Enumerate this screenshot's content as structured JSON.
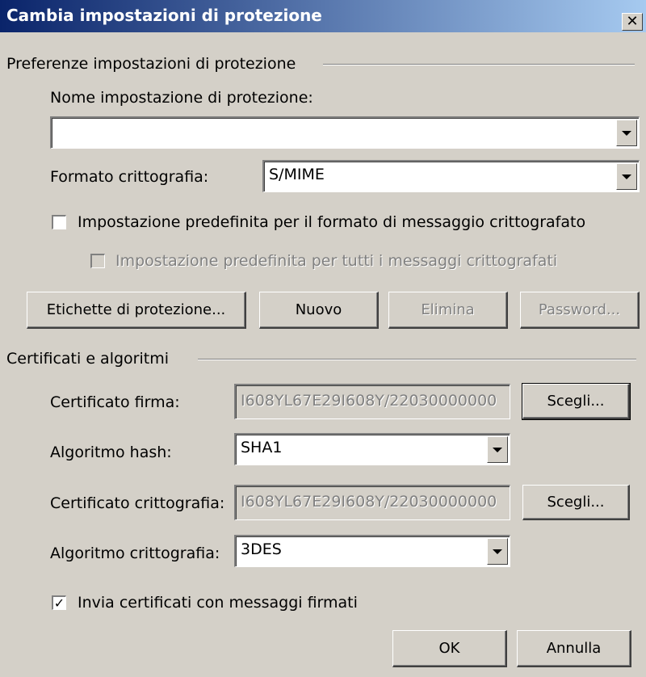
{
  "window": {
    "title": "Cambia impostazioni di protezione"
  },
  "prefs": {
    "group_label": "Preferenze impostazioni di protezione",
    "name_label": "Nome impostazione di protezione:",
    "name_value": "",
    "format_label": "Formato crittografia:",
    "format_value": "S/MIME",
    "default_format_label": "Impostazione predefinita per il formato di messaggio crittografato",
    "default_format_checked": false,
    "default_all_label": "Impostazione predefinita per tutti i messaggi crittografati",
    "default_all_checked": false
  },
  "buttons": {
    "labels": "Etichette di protezione...",
    "new": "Nuovo",
    "delete": "Elimina",
    "password": "Password...",
    "ok": "OK",
    "cancel": "Annulla"
  },
  "certs": {
    "group_label": "Certificati e algoritmi",
    "sign_cert_label": "Certificato firma:",
    "sign_cert_value": "I608YL67E29I608Y/22030000000",
    "choose": "Scegli...",
    "hash_label": "Algoritmo hash:",
    "hash_value": "SHA1",
    "enc_cert_label": "Certificato crittografia:",
    "enc_cert_value": "I608YL67E29I608Y/22030000000",
    "enc_alg_label": "Algoritmo crittografia:",
    "enc_alg_value": "3DES",
    "send_certs_label": "Invia certificati con messaggi firmati",
    "send_certs_checked": true
  }
}
